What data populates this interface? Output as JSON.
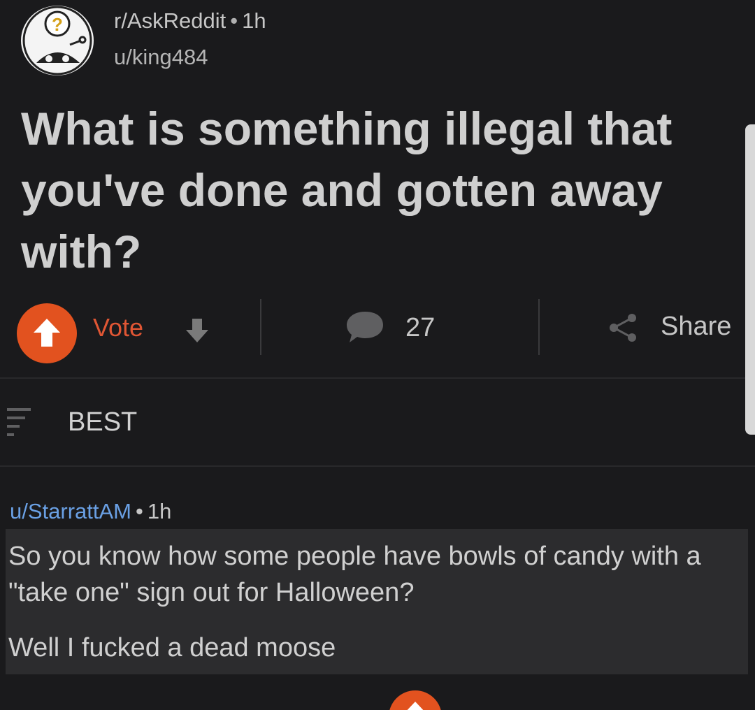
{
  "post": {
    "subreddit": "r/AskReddit",
    "separator": "•",
    "time": "1h",
    "author": "u/king484",
    "title": "What is something illegal that you've done and gotten away with?"
  },
  "actions": {
    "vote_label": "Vote",
    "comments_count": "27",
    "share_label": "Share"
  },
  "sort": {
    "label": "BEST"
  },
  "comment": {
    "author": "u/StarrattAM",
    "separator": "•",
    "time": "1h",
    "line1": "So you know how some people have bowls of candy with a \"take one\" sign out for Halloween?",
    "line2": "Well I fucked a dead moose"
  },
  "icons": {
    "avatar": "askreddit-snoo-icon",
    "upvote": "upvote-arrow-icon",
    "downvote": "downvote-arrow-icon",
    "comments": "comment-bubble-icon",
    "share": "share-icon",
    "sort": "sort-icon"
  },
  "colors": {
    "background": "#1a1a1c",
    "upvote_accent": "#e2521f",
    "author_link": "#6aa0e4"
  }
}
